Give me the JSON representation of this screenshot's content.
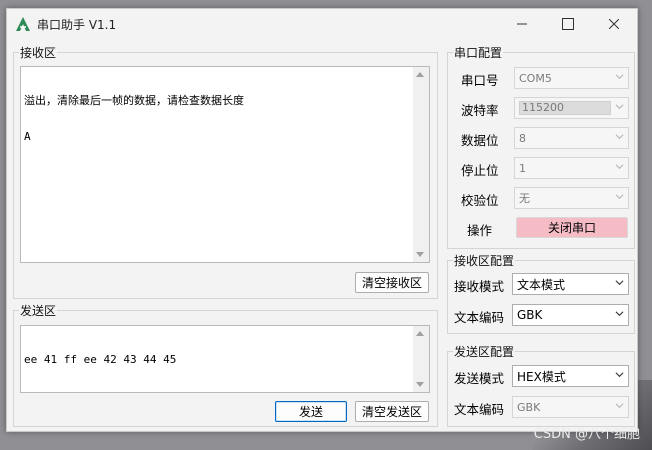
{
  "window": {
    "title": "串口助手 V1.1",
    "minimize_icon": "minimize-icon",
    "maximize_icon": "maximize-icon",
    "close_icon": "close-icon",
    "app_icon": "app-logo-icon"
  },
  "receive": {
    "group_title": "接收区",
    "text_line1": "溢出，清除最后一帧的数据，请检查数据长度",
    "text_line2": "A",
    "clear_button": "清空接收区"
  },
  "send": {
    "group_title": "发送区",
    "text": "ee 41 ff ee 42 43 44 45",
    "send_button": "发送",
    "clear_button": "清空发送区"
  },
  "serial_config": {
    "group_title": "串口配置",
    "port_label": "串口号",
    "port_value": "COM5",
    "baud_label": "波特率",
    "baud_value": "115200",
    "databits_label": "数据位",
    "databits_value": "8",
    "stopbits_label": "停止位",
    "stopbits_value": "1",
    "parity_label": "校验位",
    "parity_value": "无",
    "operation_label": "操作",
    "operation_button": "关闭串口"
  },
  "receive_config": {
    "group_title": "接收区配置",
    "mode_label": "接收模式",
    "mode_value": "文本模式",
    "encoding_label": "文本编码",
    "encoding_value": "GBK"
  },
  "send_config": {
    "group_title": "发送区配置",
    "mode_label": "发送模式",
    "mode_value": "HEX模式",
    "encoding_label": "文本编码",
    "encoding_value": "GBK"
  },
  "watermark": "CSDN @八个细胞",
  "colors": {
    "accent": "#0067c0",
    "close_port_button": "#f6bcc6",
    "window_bg": "#f3f3f3"
  }
}
